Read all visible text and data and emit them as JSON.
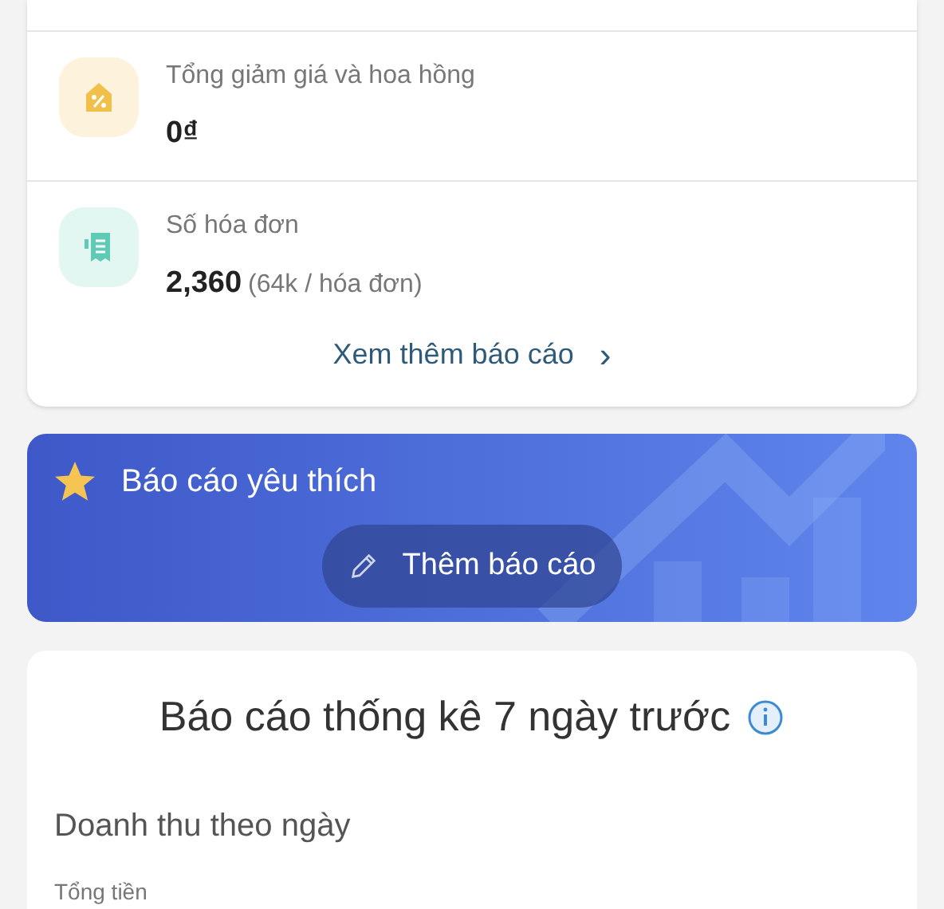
{
  "summary": {
    "stats": [
      {
        "kind": "discount",
        "label": "Tổng giảm giá và hoa hồng",
        "value": "0₫"
      },
      {
        "kind": "invoice",
        "label": "Số hóa đơn",
        "value": "2,360",
        "note": "(64k / hóa đơn)"
      }
    ],
    "more_link": "Xem thêm báo cáo",
    "more_chevron": "›"
  },
  "favorites": {
    "title": "Báo cáo yêu thích",
    "add_button": "Thêm báo cáo"
  },
  "weekly": {
    "title": "Báo cáo thống kê 7 ngày trước",
    "section": "Doanh thu theo ngày",
    "field_label": "Tổng tiền"
  }
}
